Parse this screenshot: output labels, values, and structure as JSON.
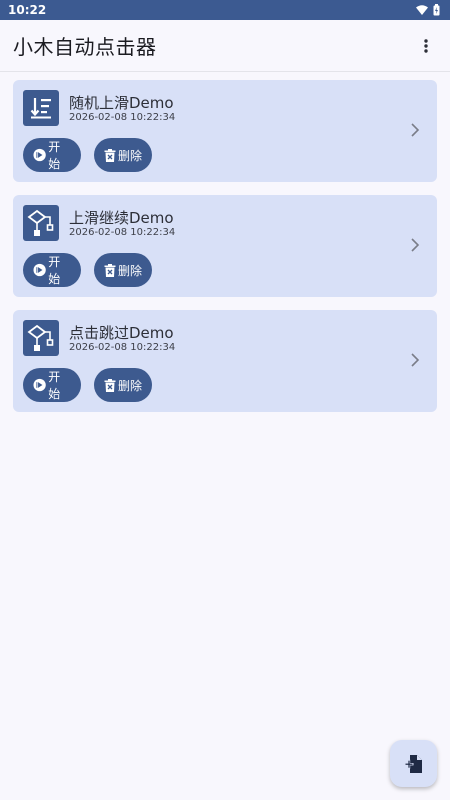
{
  "status_bar": {
    "time": "10:22",
    "icons": [
      "wifi-icon",
      "battery-icon"
    ]
  },
  "app_bar": {
    "title": "小木自动点击器",
    "menu_icon": "more-vert-icon"
  },
  "colors": {
    "primary": "#3d5a8f",
    "card_bg": "#d8e0f7",
    "page_bg": "#f8f7fd"
  },
  "tasks": [
    {
      "title": "随机上滑Demo",
      "time": "2026-02-08 10:22:34",
      "icon": "list-sort-icon",
      "start_label": "开始",
      "delete_label": "删除"
    },
    {
      "title": "上滑继续Demo",
      "time": "2026-02-08 10:22:34",
      "icon": "flowchart-icon",
      "start_label": "开始",
      "delete_label": "删除"
    },
    {
      "title": "点击跳过Demo",
      "time": "2026-02-08 10:22:34",
      "icon": "flowchart-icon",
      "start_label": "开始",
      "delete_label": "删除"
    }
  ],
  "fab": {
    "icon": "add-file-icon"
  }
}
